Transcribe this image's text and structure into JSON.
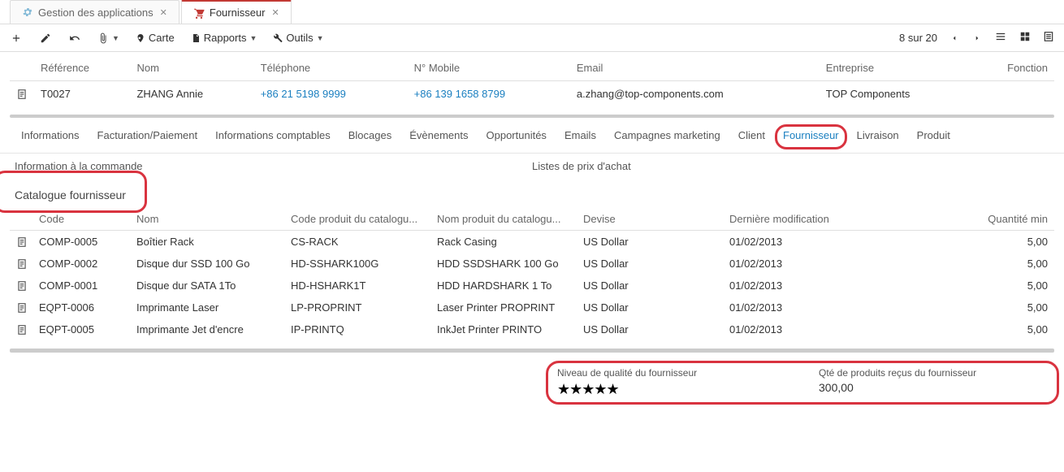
{
  "top_tabs": {
    "app_management": "Gestion des applications",
    "supplier": "Fournisseur"
  },
  "toolbar": {
    "card": "Carte",
    "reports": "Rapports",
    "tools": "Outils",
    "pagination": "8 sur 20"
  },
  "contact": {
    "headers": {
      "reference": "Référence",
      "name": "Nom",
      "phone": "Téléphone",
      "mobile": "N° Mobile",
      "email": "Email",
      "company": "Entreprise",
      "function": "Fonction"
    },
    "row": {
      "reference": "T0027",
      "name": "ZHANG Annie",
      "phone": "+86 21 5198 9999",
      "mobile": "+86 139 1658 8799",
      "email": "a.zhang@top-components.com",
      "company": "TOP Components",
      "function": ""
    }
  },
  "sub_tabs": {
    "informations": "Informations",
    "billing": "Facturation/Paiement",
    "accounting": "Informations comptables",
    "blocks": "Blocages",
    "events": "Évènements",
    "opportunities": "Opportunités",
    "emails": "Emails",
    "campaigns": "Campagnes marketing",
    "client": "Client",
    "supplier": "Fournisseur",
    "delivery": "Livraison",
    "product": "Produit"
  },
  "labels": {
    "order_info": "Information à la commande",
    "price_lists": "Listes de prix d'achat",
    "catalog_heading": "Catalogue fournisseur"
  },
  "catalog": {
    "headers": {
      "code": "Code",
      "name": "Nom",
      "product_code": "Code produit du catalogu...",
      "product_name": "Nom produit du catalogu...",
      "currency": "Devise",
      "last_modified": "Dernière modification",
      "min_qty": "Quantité min"
    },
    "rows": [
      {
        "code": "COMP-0005",
        "name": "Boîtier Rack",
        "pcode": "CS-RACK",
        "pname": "Rack Casing",
        "currency": "US Dollar",
        "modified": "01/02/2013",
        "minqty": "5,00"
      },
      {
        "code": "COMP-0002",
        "name": "Disque dur SSD 100 Go",
        "pcode": "HD-SSHARK100G",
        "pname": "HDD SSDSHARK 100 Go",
        "currency": "US Dollar",
        "modified": "01/02/2013",
        "minqty": "5,00"
      },
      {
        "code": "COMP-0001",
        "name": "Disque dur SATA 1To",
        "pcode": "HD-HSHARK1T",
        "pname": "HDD HARDSHARK 1 To",
        "currency": "US Dollar",
        "modified": "01/02/2013",
        "minqty": "5,00"
      },
      {
        "code": "EQPT-0006",
        "name": "Imprimante Laser",
        "pcode": "LP-PROPRINT",
        "pname": "Laser Printer PROPRINT",
        "currency": "US Dollar",
        "modified": "01/02/2013",
        "minqty": "5,00"
      },
      {
        "code": "EQPT-0005",
        "name": "Imprimante Jet d'encre",
        "pcode": "IP-PRINTQ",
        "pname": "InkJet Printer PRINTO",
        "currency": "US Dollar",
        "modified": "01/02/2013",
        "minqty": "5,00"
      }
    ]
  },
  "quality": {
    "label": "Niveau de qualité du fournisseur",
    "stars": "★★★★★",
    "qty_label": "Qté de produits reçus du fournisseur",
    "qty_value": "300,00"
  }
}
